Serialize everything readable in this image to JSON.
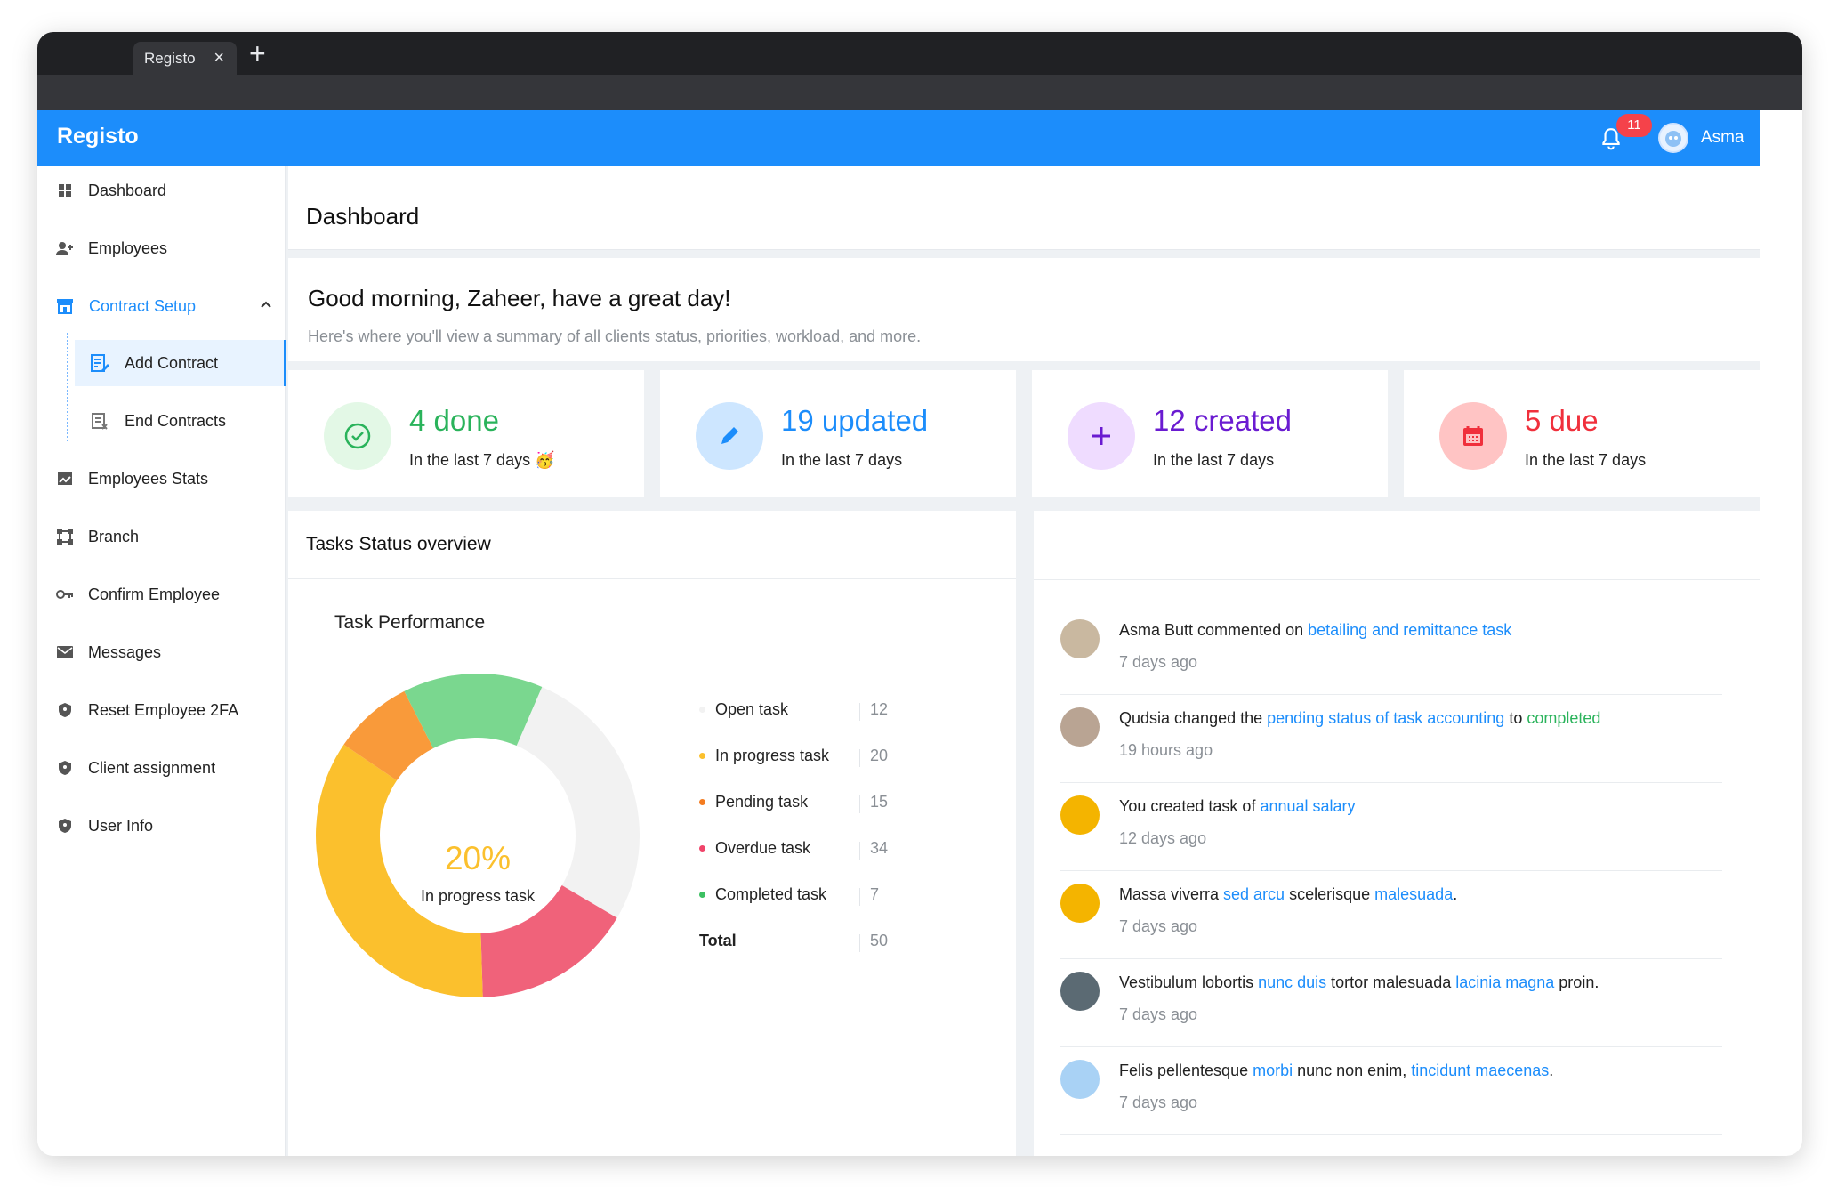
{
  "browser": {
    "tab_title": "Registo",
    "tab_close_icon": "close-icon",
    "new_tab_icon": "plus-icon"
  },
  "topbar": {
    "brand": "Registo",
    "notification_count": "11",
    "user_name": "Asma",
    "accent_color": "#1c8dfb"
  },
  "sidebar": {
    "items": [
      {
        "label": "Dashboard",
        "icon": "grid-icon"
      },
      {
        "label": "Employees",
        "icon": "user-add-icon"
      },
      {
        "label": "Contract Setup",
        "icon": "store-icon"
      },
      {
        "label": "Add Contract",
        "icon": "edit-document-icon"
      },
      {
        "label": "End Contracts",
        "icon": "document-remove-icon"
      },
      {
        "label": "Employees Stats",
        "icon": "chart-icon"
      },
      {
        "label": "Branch",
        "icon": "branch-icon"
      },
      {
        "label": "Confirm Employee",
        "icon": "key-icon"
      },
      {
        "label": "Messages",
        "icon": "mail-icon"
      },
      {
        "label": "Reset Employee 2FA",
        "icon": "shield-icon"
      },
      {
        "label": "Client assignment",
        "icon": "shield-icon"
      },
      {
        "label": "User Info",
        "icon": "shield-icon"
      }
    ]
  },
  "header": {
    "title": "Dashboard"
  },
  "greeting": {
    "title": "Good morning, Zaheer, have a great day!",
    "subtitle": "Here's where you'll view a summary of all clients status, priorities, workload, and more."
  },
  "stats": [
    {
      "value": "4 done",
      "caption": "In the last 7 days 🥳",
      "color": "#2ab35b",
      "bg": "#e3f8e6",
      "icon": "check-circle-icon"
    },
    {
      "value": "19 updated",
      "caption": "In the last 7 days",
      "color": "#1c8dfb",
      "bg": "#cde6ff",
      "icon": "pencil-icon"
    },
    {
      "value": "12 created",
      "caption": "In the last 7 days",
      "color": "#6a1bd1",
      "bg": "#efdcff",
      "icon": "plus-icon"
    },
    {
      "value": "5 due",
      "caption": "In the last 7 days",
      "color": "#f0303c",
      "bg": "#ffc4c4",
      "icon": "calendar-icon"
    }
  ],
  "tasks": {
    "heading": "Tasks Status overview",
    "chart_title": "Task Performance",
    "center_value": "20%",
    "center_label": "In progress task",
    "legend": [
      {
        "name": "Open task",
        "value": "12",
        "color": "#f2f2f2"
      },
      {
        "name": "In progress task",
        "value": "20",
        "color": "#fbc02d"
      },
      {
        "name": "Pending task",
        "value": "15",
        "color": "#f47c20"
      },
      {
        "name": "Overdue task",
        "value": "34",
        "color": "#f0446a"
      },
      {
        "name": "Completed task",
        "value": "7",
        "color": "#3cc062"
      }
    ],
    "total_label": "Total",
    "total_value": "50"
  },
  "chart_data": {
    "type": "pie",
    "title": "Task Performance",
    "categories": [
      "Open task",
      "In progress task",
      "Pending task",
      "Overdue task",
      "Completed task"
    ],
    "values": [
      12,
      20,
      15,
      34,
      7
    ],
    "total": 50,
    "display_shares": [
      0.27,
      0.35,
      0.08,
      0.16,
      0.14
    ],
    "colors": [
      "#f2f2f2",
      "#fbc02d",
      "#f99a3a",
      "#f0627a",
      "#7ad78f"
    ]
  },
  "activity": [
    {
      "avatar_color": "#c9b8a0",
      "parts": [
        {
          "t": "Asma Butt commented on "
        },
        {
          "t": "betailing and remittance task",
          "c": "lk"
        }
      ],
      "time": "7 days ago"
    },
    {
      "avatar_color": "#b9a493",
      "parts": [
        {
          "t": "Qudsia changed the  "
        },
        {
          "t": "pending status of task accounting",
          "c": "lk"
        },
        {
          "t": " to "
        },
        {
          "t": "completed",
          "c": "gr"
        }
      ],
      "time": "19 hours ago"
    },
    {
      "avatar_color": "#f4b400",
      "parts": [
        {
          "t": "You created task of "
        },
        {
          "t": "annual salary",
          "c": "lk"
        }
      ],
      "time": "12  days ago"
    },
    {
      "avatar_color": "#f4b400",
      "parts": [
        {
          "t": "Massa viverra "
        },
        {
          "t": "sed arcu",
          "c": "lk"
        },
        {
          "t": " scelerisque "
        },
        {
          "t": "malesuada",
          "c": "lk"
        },
        {
          "t": "."
        }
      ],
      "time": "7 days ago"
    },
    {
      "avatar_color": "#5b6a73",
      "parts": [
        {
          "t": "Vestibulum lobortis "
        },
        {
          "t": "nunc duis",
          "c": "lk"
        },
        {
          "t": " tortor malesuada "
        },
        {
          "t": "lacinia magna",
          "c": "lk"
        },
        {
          "t": " proin."
        }
      ],
      "time": "7 days ago"
    },
    {
      "avatar_color": "#a9d2f5",
      "parts": [
        {
          "t": "Felis pellentesque "
        },
        {
          "t": "morbi",
          "c": "lk"
        },
        {
          "t": " nunc non enim, "
        },
        {
          "t": "tincidunt maecenas",
          "c": "lk"
        },
        {
          "t": "."
        }
      ],
      "time": "7 days ago"
    }
  ]
}
